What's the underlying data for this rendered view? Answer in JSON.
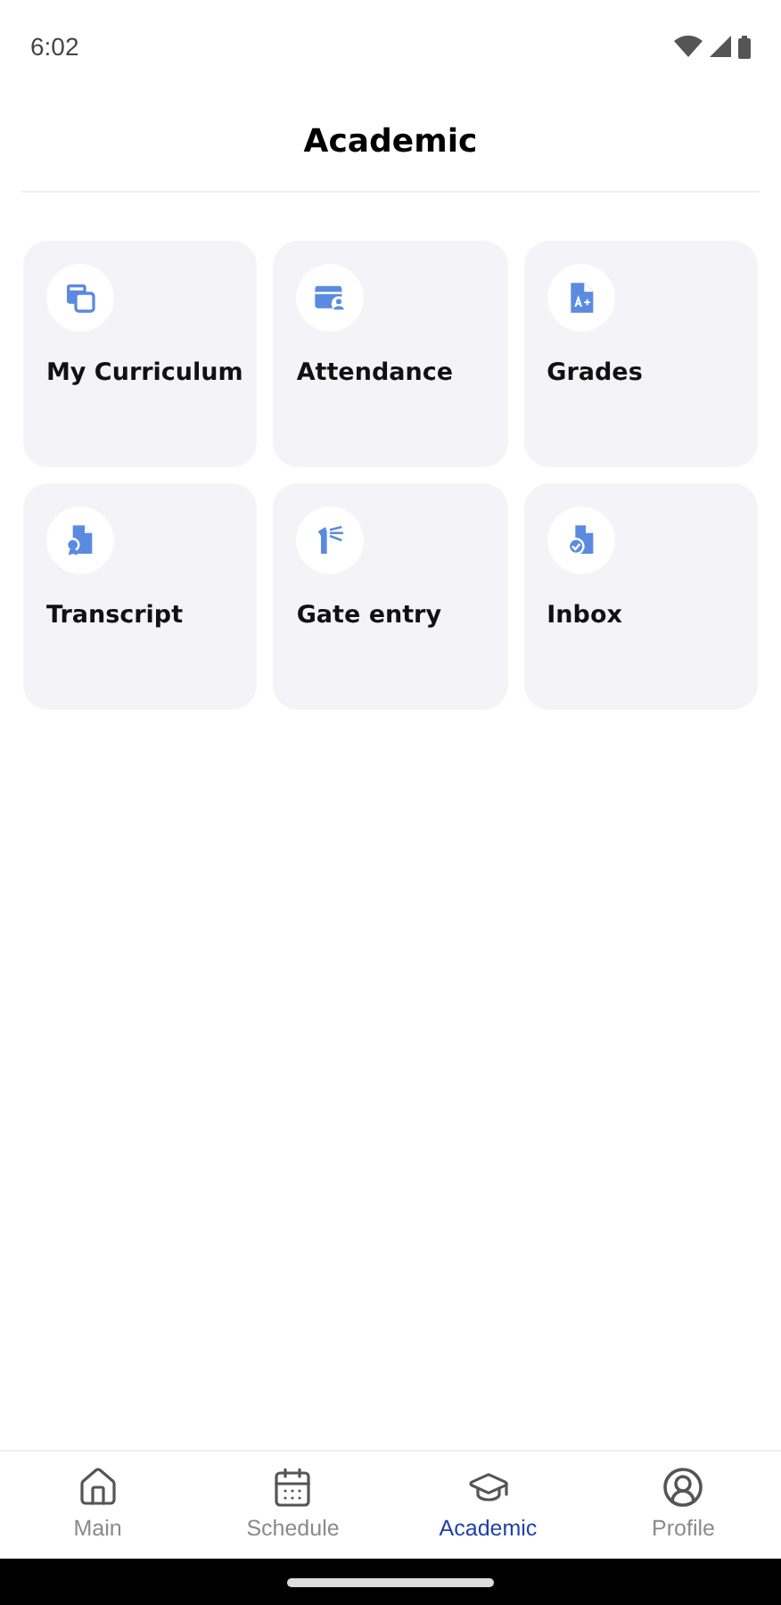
{
  "status_bar": {
    "time": "6:02"
  },
  "header": {
    "title": "Academic"
  },
  "tiles": [
    {
      "label": "My Curriculum"
    },
    {
      "label": "Attendance"
    },
    {
      "label": "Grades"
    },
    {
      "label": "Transcript"
    },
    {
      "label": "Gate entry"
    },
    {
      "label": "Inbox"
    }
  ],
  "bottom_nav": [
    {
      "label": "Main",
      "selected": false
    },
    {
      "label": "Schedule",
      "selected": false
    },
    {
      "label": "Academic",
      "selected": true
    },
    {
      "label": "Profile",
      "selected": false
    }
  ]
}
